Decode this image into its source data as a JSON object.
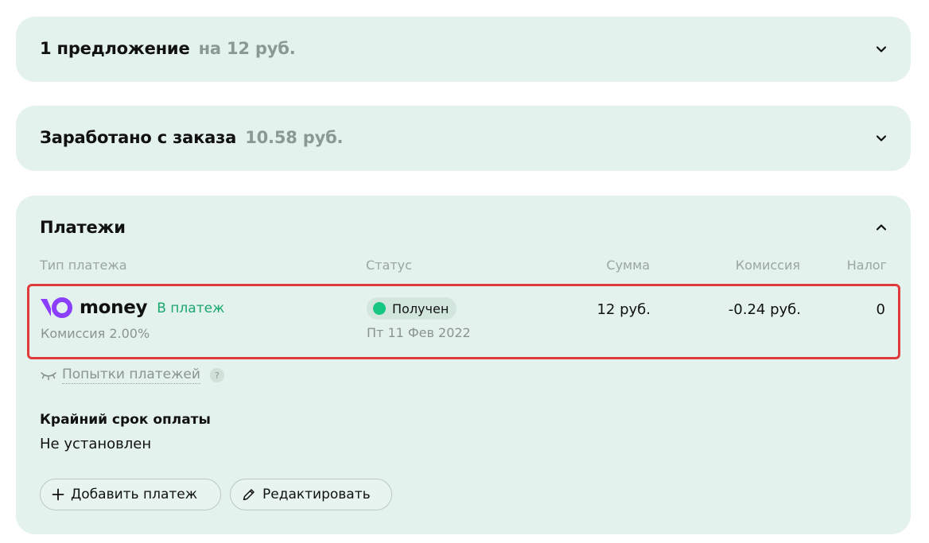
{
  "offers": {
    "title": "1 предложение",
    "amount": "на 12 руб."
  },
  "earned": {
    "title": "Заработано с заказа",
    "amount": "10.58 руб."
  },
  "payments": {
    "title": "Платежи",
    "columns": {
      "type": "Тип платежа",
      "status": "Статус",
      "amount": "Сумма",
      "commission": "Комиссия",
      "tax": "Налог"
    },
    "row": {
      "provider": "money",
      "action": "В платеж",
      "commission_note": "Комиссия 2.00%",
      "status": "Получен",
      "date": "Пт 11 Фев 2022",
      "amount": "12 руб.",
      "commission": "-0.24 руб.",
      "tax": "0"
    },
    "attempts_label": "Попытки платежей",
    "help_symbol": "?",
    "deadline": {
      "label": "Крайний срок оплаты",
      "value": "Не установлен"
    },
    "buttons": {
      "add": "Добавить платеж",
      "edit": "Редактировать"
    }
  },
  "colors": {
    "card_bg": "#e3f2ec",
    "accent_green": "#1aa86f",
    "status_dot": "#16c784",
    "highlight_border": "#e03a3a",
    "logo_purple": "#8b3ffd"
  },
  "icons": {
    "collapse": "chevron-down-icon",
    "expand": "chevron-up-icon",
    "attempts": "eye-closed-icon",
    "add": "plus-icon",
    "edit": "pencil-icon",
    "logo": "yoomoney-logo-icon"
  }
}
